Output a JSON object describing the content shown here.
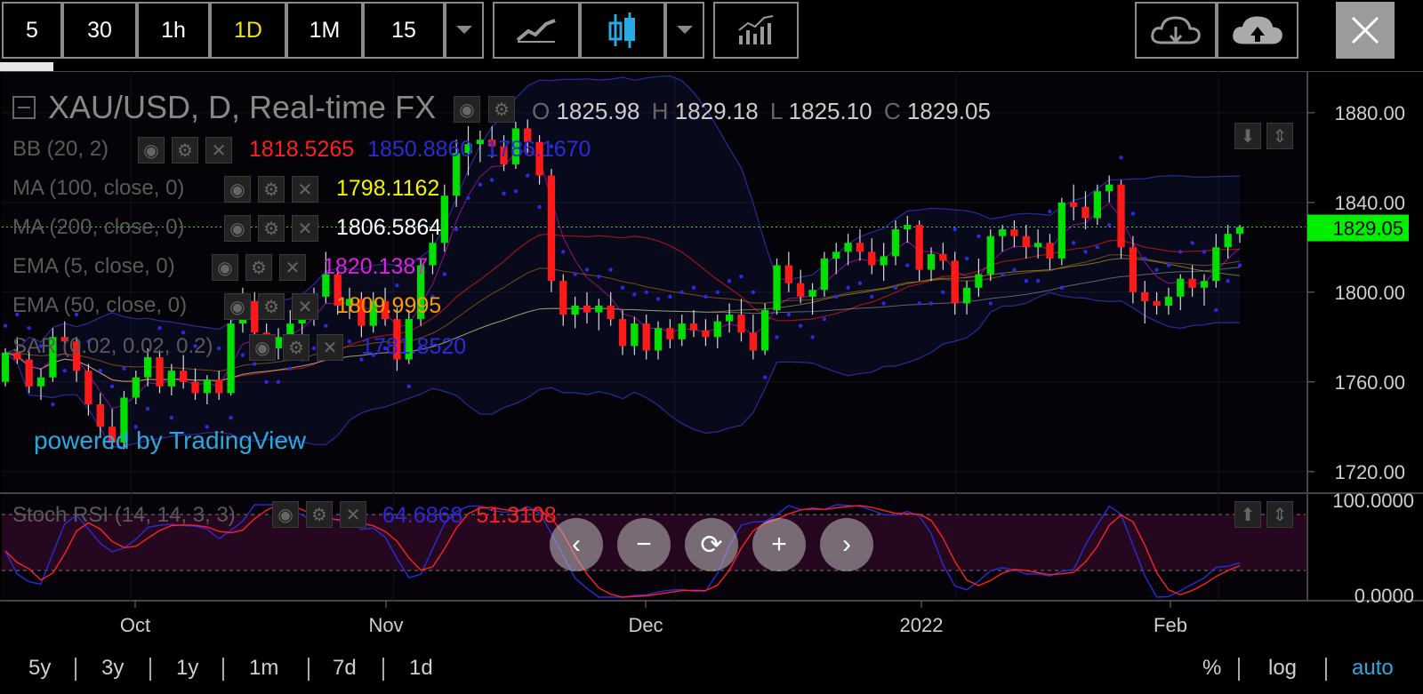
{
  "toolbar": {
    "intervals": [
      "5",
      "30",
      "1h",
      "1D",
      "1M",
      "15"
    ],
    "active_interval": "1D",
    "dropdown_icon": "caret-down-icon",
    "line_chart_icon": "line-chart-icon",
    "candle_chart_icon": "candlestick-icon",
    "indicators_icon": "indicators-icon",
    "download_icon": "cloud-download-icon",
    "upload_icon": "cloud-upload-icon",
    "close_icon": "close-icon"
  },
  "header": {
    "symbol": "XAU/USD, D, Real-time FX",
    "o_label": "O",
    "o_value": "1825.98",
    "h_label": "H",
    "h_value": "1829.18",
    "l_label": "L",
    "l_value": "1825.10",
    "c_label": "C",
    "c_value": "1829.05"
  },
  "indicators": [
    {
      "name": "BB (20, 2)",
      "values": [
        "1818.5265",
        "1850.8860",
        "1786.1670"
      ],
      "colors": [
        "#ff2020",
        "#2b2bd8",
        "#2b2bd8"
      ]
    },
    {
      "name": "MA (100, close, 0)",
      "values": [
        "1798.1162"
      ],
      "colors": [
        "#f5f500"
      ]
    },
    {
      "name": "MA (200, close, 0)",
      "values": [
        "1806.5864"
      ],
      "colors": [
        "#ffffff"
      ]
    },
    {
      "name": "EMA (5, close, 0)",
      "values": [
        "1820.1387"
      ],
      "colors": [
        "#e020e0"
      ]
    },
    {
      "name": "EMA (50, close, 0)",
      "values": [
        "1809.9995"
      ],
      "colors": [
        "#ff9a00"
      ]
    },
    {
      "name": "SAR (0.02, 0.02, 0.2)",
      "values": [
        "1781.8520"
      ],
      "colors": [
        "#2b2bd8"
      ]
    }
  ],
  "watermark": "powered by TradingView",
  "price_axis": {
    "ticks": [
      "1880.00",
      "1840.00",
      "1800.00",
      "1760.00",
      "1720.00"
    ],
    "last_price": "1829.05",
    "last_price_color": "#00ee00"
  },
  "stoch": {
    "name": "Stoch RSI (14, 14, 3, 3)",
    "k_value": "64.6868",
    "k_color": "#2b2bd8",
    "d_value": "51.3108",
    "d_color": "#ff2020",
    "axis_top": "100.0000",
    "axis_bottom": "0.0000"
  },
  "time_axis": {
    "labels": [
      "Oct",
      "Nov",
      "Dec",
      "2022",
      "Feb"
    ]
  },
  "nav_icons": [
    "chevron-left-icon",
    "zoom-out-icon",
    "reset-icon",
    "zoom-in-icon",
    "chevron-right-icon"
  ],
  "ranges": [
    "5y",
    "3y",
    "1y",
    "1m",
    "7d",
    "1d"
  ],
  "scale_options": {
    "percent": "%",
    "log": "log",
    "auto": "auto"
  },
  "colors": {
    "up": "#00e000",
    "down": "#ff1a1a",
    "accent": "#2aa9e0",
    "bb": "#3a3ad8"
  },
  "chart_data": {
    "type": "candlestick",
    "interval": "1D",
    "symbol": "XAU/USD",
    "ylim": [
      1710,
      1895
    ],
    "y_ticks": [
      1880,
      1840,
      1800,
      1760,
      1720
    ],
    "stoch_ylim": [
      0,
      100
    ],
    "candles": [
      [
        1760,
        1775,
        1758,
        1773
      ],
      [
        1773,
        1780,
        1768,
        1770
      ],
      [
        1770,
        1774,
        1755,
        1758
      ],
      [
        1758,
        1766,
        1752,
        1762
      ],
      [
        1762,
        1784,
        1760,
        1780
      ],
      [
        1780,
        1787,
        1775,
        1778
      ],
      [
        1778,
        1780,
        1760,
        1765
      ],
      [
        1765,
        1768,
        1745,
        1750
      ],
      [
        1750,
        1755,
        1735,
        1740
      ],
      [
        1740,
        1748,
        1730,
        1733
      ],
      [
        1733,
        1756,
        1730,
        1753
      ],
      [
        1753,
        1765,
        1750,
        1762
      ],
      [
        1762,
        1775,
        1758,
        1771
      ],
      [
        1771,
        1774,
        1755,
        1758
      ],
      [
        1758,
        1768,
        1754,
        1765
      ],
      [
        1765,
        1772,
        1757,
        1760
      ],
      [
        1760,
        1766,
        1752,
        1755
      ],
      [
        1755,
        1763,
        1750,
        1761
      ],
      [
        1761,
        1765,
        1752,
        1755
      ],
      [
        1755,
        1790,
        1754,
        1786
      ],
      [
        1786,
        1802,
        1782,
        1796
      ],
      [
        1796,
        1800,
        1778,
        1782
      ],
      [
        1782,
        1786,
        1770,
        1775
      ],
      [
        1775,
        1784,
        1770,
        1780
      ],
      [
        1780,
        1792,
        1776,
        1786
      ],
      [
        1786,
        1796,
        1780,
        1790
      ],
      [
        1790,
        1802,
        1785,
        1798
      ],
      [
        1798,
        1818,
        1795,
        1808
      ],
      [
        1808,
        1810,
        1790,
        1794
      ],
      [
        1794,
        1802,
        1788,
        1797
      ],
      [
        1797,
        1800,
        1780,
        1785
      ],
      [
        1785,
        1800,
        1782,
        1796
      ],
      [
        1796,
        1802,
        1785,
        1788
      ],
      [
        1788,
        1793,
        1765,
        1770
      ],
      [
        1770,
        1792,
        1768,
        1788
      ],
      [
        1788,
        1815,
        1785,
        1812
      ],
      [
        1812,
        1826,
        1808,
        1822
      ],
      [
        1822,
        1848,
        1818,
        1843
      ],
      [
        1843,
        1868,
        1838,
        1862
      ],
      [
        1862,
        1874,
        1852,
        1866
      ],
      [
        1866,
        1872,
        1858,
        1868
      ],
      [
        1868,
        1874,
        1860,
        1865
      ],
      [
        1865,
        1870,
        1854,
        1857
      ],
      [
        1857,
        1876,
        1855,
        1873
      ],
      [
        1873,
        1877,
        1862,
        1867
      ],
      [
        1867,
        1870,
        1848,
        1852
      ],
      [
        1852,
        1855,
        1800,
        1805
      ],
      [
        1805,
        1808,
        1785,
        1790
      ],
      [
        1790,
        1798,
        1784,
        1794
      ],
      [
        1794,
        1800,
        1786,
        1791
      ],
      [
        1791,
        1797,
        1783,
        1794
      ],
      [
        1794,
        1800,
        1785,
        1788
      ],
      [
        1788,
        1792,
        1772,
        1776
      ],
      [
        1776,
        1789,
        1772,
        1786
      ],
      [
        1786,
        1790,
        1770,
        1774
      ],
      [
        1774,
        1787,
        1770,
        1784
      ],
      [
        1784,
        1788,
        1775,
        1779
      ],
      [
        1779,
        1790,
        1776,
        1786
      ],
      [
        1786,
        1792,
        1780,
        1783
      ],
      [
        1783,
        1788,
        1776,
        1780
      ],
      [
        1780,
        1790,
        1775,
        1787
      ],
      [
        1787,
        1795,
        1782,
        1790
      ],
      [
        1790,
        1797,
        1778,
        1782
      ],
      [
        1782,
        1790,
        1770,
        1774
      ],
      [
        1774,
        1795,
        1772,
        1792
      ],
      [
        1792,
        1815,
        1790,
        1812
      ],
      [
        1812,
        1818,
        1800,
        1804
      ],
      [
        1804,
        1810,
        1795,
        1798
      ],
      [
        1798,
        1804,
        1790,
        1801
      ],
      [
        1801,
        1818,
        1798,
        1815
      ],
      [
        1815,
        1822,
        1808,
        1818
      ],
      [
        1818,
        1826,
        1812,
        1822
      ],
      [
        1822,
        1828,
        1814,
        1818
      ],
      [
        1818,
        1824,
        1808,
        1812
      ],
      [
        1812,
        1822,
        1805,
        1816
      ],
      [
        1816,
        1832,
        1812,
        1828
      ],
      [
        1828,
        1834,
        1822,
        1830
      ],
      [
        1830,
        1832,
        1805,
        1810
      ],
      [
        1810,
        1820,
        1805,
        1817
      ],
      [
        1817,
        1822,
        1810,
        1814
      ],
      [
        1814,
        1818,
        1790,
        1795
      ],
      [
        1795,
        1805,
        1790,
        1802
      ],
      [
        1802,
        1815,
        1798,
        1808
      ],
      [
        1808,
        1828,
        1805,
        1825
      ],
      [
        1825,
        1830,
        1818,
        1828
      ],
      [
        1828,
        1832,
        1820,
        1825
      ],
      [
        1825,
        1830,
        1815,
        1820
      ],
      [
        1820,
        1828,
        1815,
        1822
      ],
      [
        1822,
        1826,
        1810,
        1815
      ],
      [
        1815,
        1842,
        1812,
        1840
      ],
      [
        1840,
        1848,
        1832,
        1838
      ],
      [
        1838,
        1845,
        1828,
        1833
      ],
      [
        1833,
        1848,
        1830,
        1845
      ],
      [
        1845,
        1852,
        1840,
        1848
      ],
      [
        1848,
        1850,
        1815,
        1820
      ],
      [
        1820,
        1825,
        1795,
        1800
      ],
      [
        1800,
        1805,
        1786,
        1796
      ],
      [
        1796,
        1800,
        1790,
        1794
      ],
      [
        1794,
        1802,
        1790,
        1798
      ],
      [
        1798,
        1808,
        1792,
        1806
      ],
      [
        1806,
        1812,
        1798,
        1802
      ],
      [
        1802,
        1808,
        1794,
        1805
      ],
      [
        1805,
        1826,
        1802,
        1820
      ],
      [
        1820,
        1830,
        1815,
        1826
      ],
      [
        1826,
        1830,
        1822,
        1829.05
      ]
    ]
  }
}
